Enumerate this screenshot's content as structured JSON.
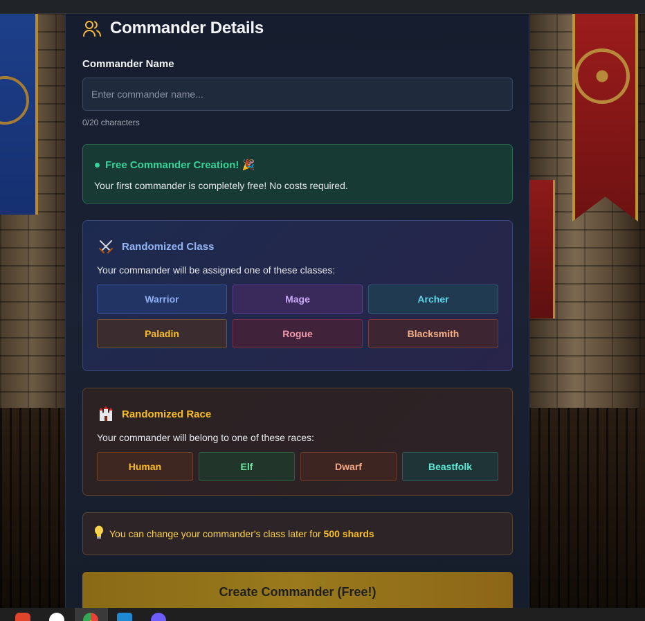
{
  "header": {
    "title": "Commander Details",
    "icon": "users-icon"
  },
  "name_field": {
    "label": "Commander Name",
    "placeholder": "Enter commander name...",
    "value": "",
    "counter": "0/20 characters"
  },
  "free_notice": {
    "title": "Free Commander Creation! 🎉",
    "description": "Your first commander is completely free! No costs required."
  },
  "class_section": {
    "icon": "crossed-swords-icon",
    "title": "Randomized Class",
    "description": "Your commander will be assigned one of these classes:",
    "classes": [
      "Warrior",
      "Mage",
      "Archer",
      "Paladin",
      "Rogue",
      "Blacksmith"
    ]
  },
  "race_section": {
    "icon": "castle-icon",
    "title": "Randomized Race",
    "description": "Your commander will belong to one of these races:",
    "races": [
      "Human",
      "Elf",
      "Dwarf",
      "Beastfolk"
    ]
  },
  "tip": {
    "icon": "lightbulb-icon",
    "text": "You can change your commander's class later for ",
    "highlight": "500 shards"
  },
  "create_button": {
    "label": "Create Commander (Free!)"
  },
  "colors": {
    "accent_green": "#34d399",
    "accent_gold": "#fbbf24",
    "accent_blue": "#93b4f5"
  }
}
